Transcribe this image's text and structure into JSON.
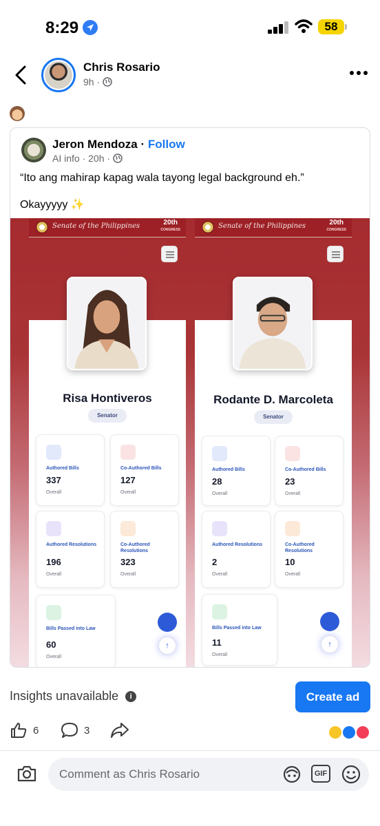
{
  "status_bar": {
    "time": "8:29",
    "battery": "58"
  },
  "post": {
    "author": "Chris Rosario",
    "time": "9h ·",
    "emoji": "🙊",
    "icons": [
      "back-arrow-icon",
      "globe-icon",
      "more-icon"
    ]
  },
  "shared": {
    "author": "Jeron Mendoza",
    "separator": " · ",
    "follow": "Follow",
    "meta": "AI info · 20h ·",
    "text_line1": "“Ito ang mahirap kapag wala tayong legal background eh.”",
    "text_line2": "Okayyyyy",
    "sparkle": "✨"
  },
  "screens": [
    {
      "header_title": "Senate of the Philippines",
      "congress": "20th",
      "congress_sub": "CONGRESS",
      "name": "Risa Hontiveros",
      "role": "Senator",
      "stats": [
        {
          "label": "Authored Bills",
          "value": "337",
          "sub": "Overall"
        },
        {
          "label": "Co-Authored Bills",
          "value": "127",
          "sub": "Overall"
        },
        {
          "label": "Authored Resolutions",
          "value": "196",
          "sub": "Overall"
        },
        {
          "label": "Co-Authored Resolutions",
          "value": "323",
          "sub": "Overall"
        },
        {
          "label": "Bills Passed into Law",
          "value": "60",
          "sub": "Overall"
        }
      ]
    },
    {
      "header_title": "Senate of the Philippines",
      "congress": "20th",
      "congress_sub": "CONGRESS",
      "name": "Rodante D. Marcoleta",
      "role": "Senator",
      "stats": [
        {
          "label": "Authored Bills",
          "value": "28",
          "sub": "Overall"
        },
        {
          "label": "Co-Authored Bills",
          "value": "23",
          "sub": "Overall"
        },
        {
          "label": "Authored Resolutions",
          "value": "2",
          "sub": "Overall"
        },
        {
          "label": "Co-Authored Resolutions",
          "value": "10",
          "sub": "Overall"
        },
        {
          "label": "Bills Passed into Law",
          "value": "11",
          "sub": "Overall"
        }
      ]
    }
  ],
  "insights": {
    "text": "Insights unavailable",
    "info": "i",
    "create_ad": "Create ad"
  },
  "actions": {
    "likes": "6",
    "comments": "3"
  },
  "comment": {
    "placeholder": "Comment as Chris Rosario",
    "gif": "GIF"
  },
  "colors": {
    "accent": "#1877f2",
    "senate_red": "#a52b2f"
  }
}
